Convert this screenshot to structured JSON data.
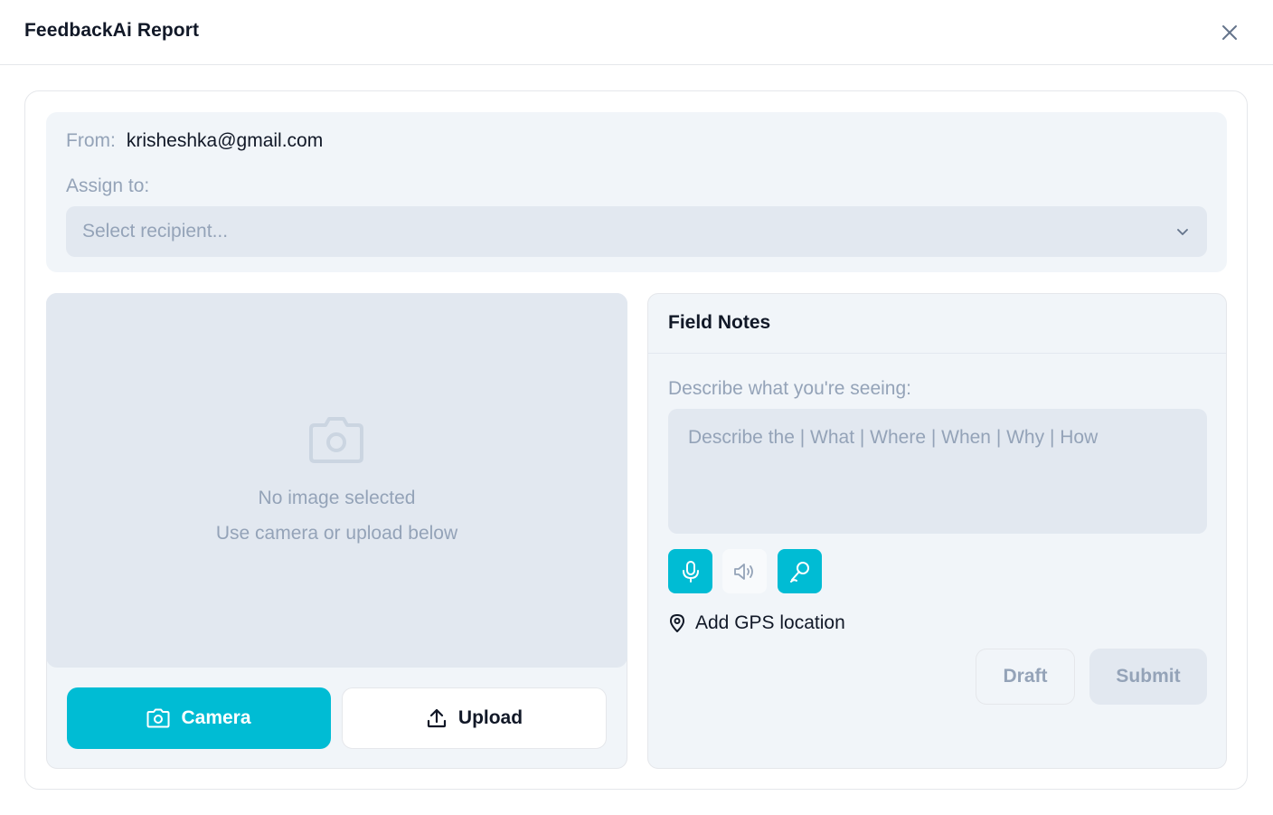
{
  "header": {
    "title": "FeedbackAi Report",
    "close_icon": "close-icon"
  },
  "sender": {
    "from_label": "From:",
    "from_value": "krisheshka@gmail.com"
  },
  "assign": {
    "label": "Assign to:",
    "selected": "Select recipient...",
    "chevron_icon": "chevron-down-icon"
  },
  "image_panel": {
    "placeholder_icon": "camera-icon",
    "empty_title": "No image selected",
    "empty_hint": "Use camera or upload below",
    "camera_label": "Camera",
    "upload_label": "Upload"
  },
  "field_notes": {
    "title": "Field Notes",
    "describe_label": "Describe what you're seeing:",
    "textarea_placeholder": "Describe the | What | Where | When | Why | How",
    "textarea_value": "",
    "tools": [
      "microphone-icon",
      "speaker-icon",
      "pen-icon"
    ],
    "gps_label": "Add GPS location",
    "draft_label": "Draft",
    "submit_label": "Submit"
  },
  "colors": {
    "accent": "#00bcd4",
    "panel_bg": "#f1f5f9",
    "input_bg": "#e2e8f0",
    "muted_text": "#94a3b8"
  }
}
